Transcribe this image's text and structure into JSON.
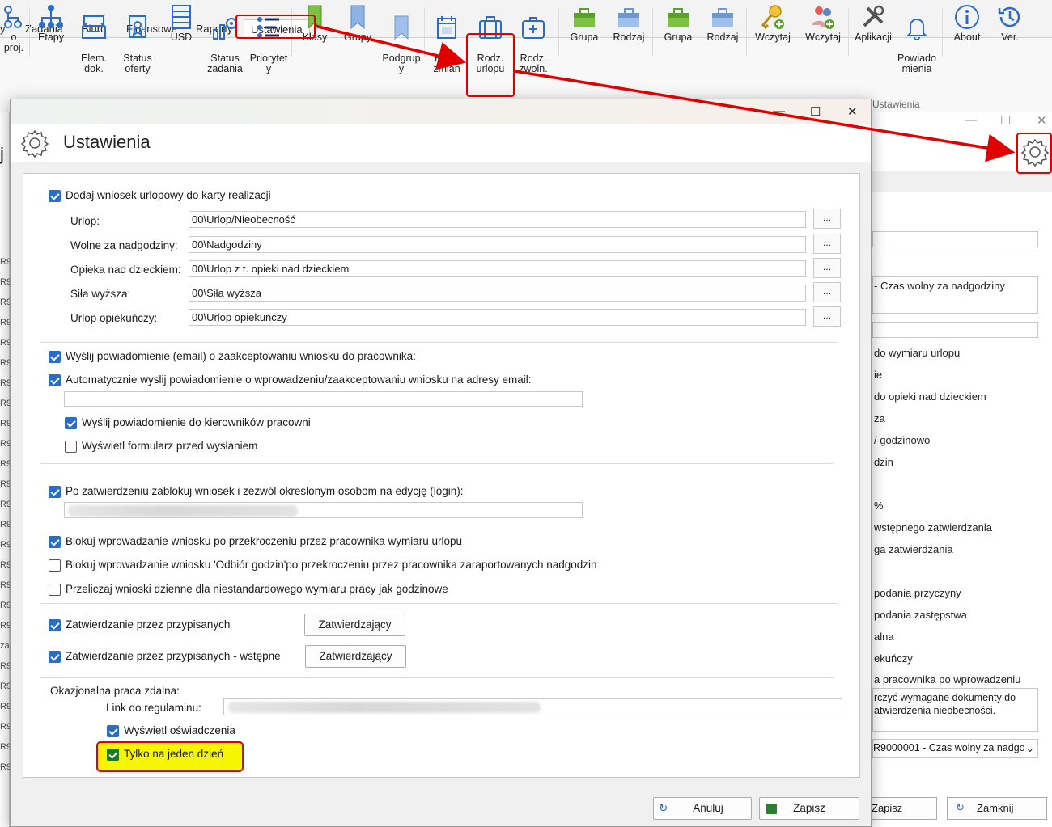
{
  "ribbon_tabs": [
    "y",
    "Zadania",
    "Biuro",
    "Finansowe",
    "Raporty",
    "Ustawienia"
  ],
  "ribbon_buttons": {
    "proj": "o proj.",
    "etapy": "Etapy",
    "elem": "Elem.\ndok.",
    "status_oferty": "Status\noferty",
    "usd": "USD",
    "status_zadania": "Status\nzadania",
    "priorytety": "Priorytet\ny",
    "klasy": "Klasy",
    "grupy": "Grupy",
    "podgrupy": "Podgrup\ny",
    "karta_zmian": "Karta\nzmian",
    "rodz_urlopu": "Rodz.\nurlopu",
    "rodz_zwoln": "Rodz.\nzwoln.",
    "grupa1": "Grupa",
    "rodzaj1": "Rodzaj",
    "grupa2": "Grupa",
    "rodzaj2": "Rodzaj",
    "wczytaj1": "Wczytaj",
    "wczytaj2": "Wczytaj",
    "aplikacji": "Aplikacji",
    "powiadomienia": "Powiado\nmienia",
    "about": "About",
    "ver": "Ver.",
    "group_label": "Ustawienia"
  },
  "dialog": {
    "title": "Ustawienia",
    "add_to_card": "Dodaj wniosek urlopowy do karty realizacji",
    "fields": [
      {
        "label": "Urlop:",
        "value": "00\\Urlop/Nieobecność"
      },
      {
        "label": "Wolne za nadgodziny:",
        "value": "00\\Nadgodziny"
      },
      {
        "label": "Opieka nad dzieckiem:",
        "value": "00\\Urlop z t. opieki nad dzieckiem"
      },
      {
        "label": "Siła wyższa:",
        "value": "00\\Siła wyższa"
      },
      {
        "label": "Urlop opiekuńczy:",
        "value": "00\\Urlop opiekuńczy"
      }
    ],
    "dots": "...",
    "send_email": "Wyślij powiadomienie (email) o zaakceptowaniu wniosku do pracownika:",
    "auto_send": "Automatycznie wyslij powiadomienie o wprowadzeniu/zaakceptowaniu wniosku na adresy email:",
    "send_managers": "Wyślij powiadomienie do kierowników pracowni",
    "show_form": "Wyświetl formularz przed wysłaniem",
    "lock_after": "Po zatwierdzeniu zablokuj wniosek i zezwól określonym osobom na edycję (login):",
    "block_exceed": "Blokuj wprowadzanie wniosku po przekroczeniu przez pracownika wymiaru urlopu",
    "block_odbior": "Blokuj wprowadzanie wniosku 'Odbiór godzin'po przekroczeniu przez pracownika zaraportowanych nadgodzin",
    "recalc": "Przeliczaj wnioski dzienne dla niestandardowego wymiaru pracy jak godzinowe",
    "approve_assigned": "Zatwierdzanie przez przypisanych",
    "approve_assigned_pre": "Zatwierdzanie przez przypisanych - wstępne",
    "approvers_btn": "Zatwierdzający",
    "remote_title": "Okazjonalna praca zdalna:",
    "regulations_link": "Link do regulaminu:",
    "show_statements": "Wyświetl oświadczenia",
    "one_day_only": "Tylko na jeden dzień",
    "cancel": "Anuluj",
    "save": "Zapisz"
  },
  "background": {
    "lines": [
      "- Czas wolny za nadgodziny",
      "do wymiaru urlopu",
      "ie",
      "do opieki nad dzieckiem",
      "za",
      "/ godzinowo",
      "dzin",
      "%",
      "wstępnego zatwierdzania",
      "ga zatwierdzania",
      "podania przyczyny",
      "podania zastępstwa",
      "alna",
      "ekuńczy",
      "a pracownika po wprowadzeniu"
    ],
    "note": "rczyć wymagane dokumenty do\natwierdzenia nieobecności.",
    "select": "R9000001 - Czas wolny za nadgo",
    "save": "Zapisz",
    "close": "Zamknij",
    "left_rows": [
      "R9",
      "R9",
      "R9",
      "R9",
      "R9",
      "R9",
      "R9",
      "R9",
      "R9",
      "R9",
      "R9",
      "R9",
      "R9",
      "R9",
      "R9",
      "R9",
      "R9",
      "R9",
      "R9",
      "za",
      "R9",
      "R9",
      "R9",
      "R9",
      "R9",
      "R9"
    ],
    "left_letter": "j"
  },
  "colors": {
    "checkbox": "#2b6cc4",
    "annotation": "#e00000",
    "highlight": "#f6f600"
  }
}
